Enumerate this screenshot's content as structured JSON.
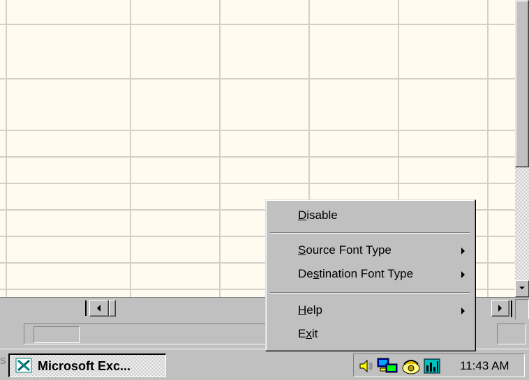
{
  "context_menu": {
    "items": [
      {
        "pre": "",
        "key": "D",
        "post": "isable",
        "submenu": false
      },
      {
        "pre": "",
        "key": "S",
        "post": "ource Font Type",
        "submenu": true
      },
      {
        "pre": "De",
        "key": "s",
        "post": "tination Font Type",
        "submenu": true
      },
      {
        "pre": "",
        "key": "H",
        "post": "elp",
        "submenu": true
      },
      {
        "pre": "E",
        "key": "x",
        "post": "it",
        "submenu": false
      }
    ]
  },
  "taskbar": {
    "start_edge_text": "s",
    "task_button_label": "Microsoft Exc...",
    "clock": "11:43 AM",
    "tray_icons": [
      "speaker-icon",
      "network-monitor-icon",
      "phone-icon",
      "system-meter-icon"
    ]
  },
  "colors": {
    "sheet_background": "#fffbf0",
    "gridline": "#d4d0c8",
    "chrome": "#c0c0c0"
  }
}
